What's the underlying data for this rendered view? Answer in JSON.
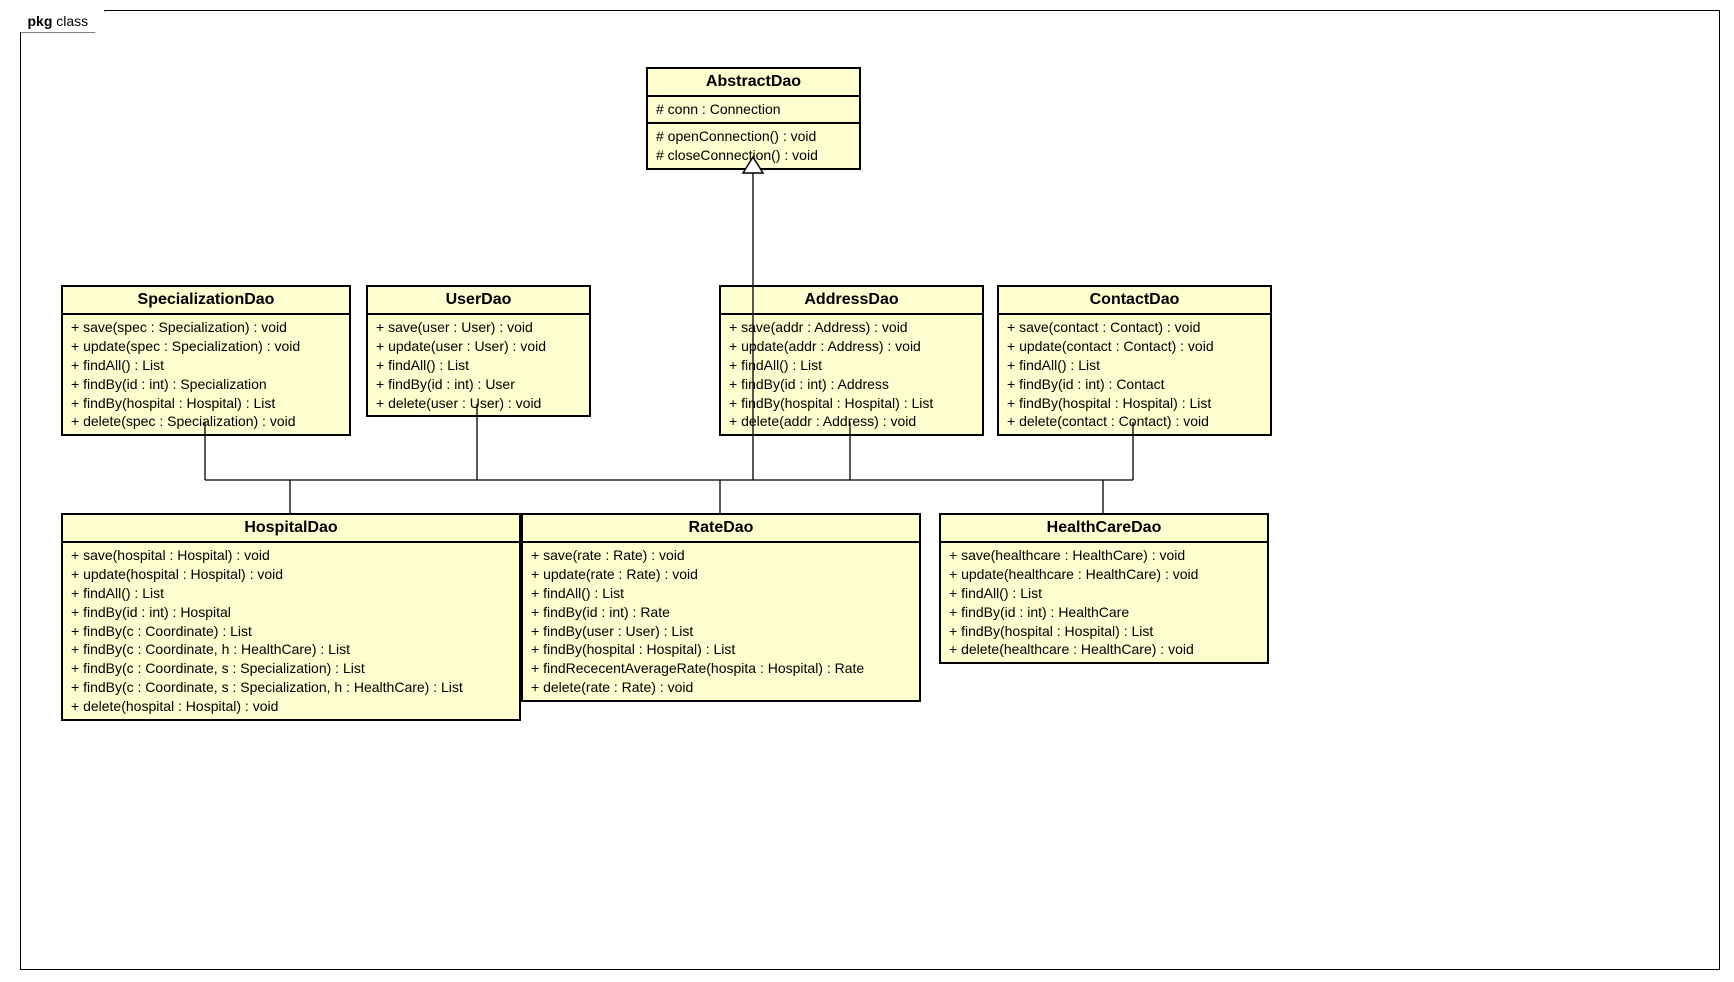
{
  "frame": {
    "pkg_label": "pkg",
    "name": "class"
  },
  "classes": {
    "abstractDao": {
      "title": "AbstractDao",
      "attrs": [
        "# conn : Connection"
      ],
      "ops": [
        "# openConnection() : void",
        "# closeConnection() : void"
      ]
    },
    "specializationDao": {
      "title": "SpecializationDao",
      "ops": [
        "+ save(spec : Specialization) : void",
        "+ update(spec : Specialization) : void",
        "+ findAll() : List",
        "+ findBy(id : int) : Specialization",
        "+ findBy(hospital : Hospital) : List",
        "+ delete(spec : Specialization) : void"
      ]
    },
    "userDao": {
      "title": "UserDao",
      "ops": [
        "+ save(user : User) : void",
        "+ update(user : User) : void",
        "+ findAll() : List",
        "+ findBy(id : int) : User",
        "+ delete(user : User) : void"
      ]
    },
    "addressDao": {
      "title": "AddressDao",
      "ops": [
        "+ save(addr : Address) : void",
        "+ update(addr : Address) : void",
        "+ findAll() : List",
        "+ findBy(id : int) : Address",
        "+ findBy(hospital : Hospital) : List",
        "+ delete(addr : Address) : void"
      ]
    },
    "contactDao": {
      "title": "ContactDao",
      "ops": [
        "+ save(contact : Contact) : void",
        "+ update(contact : Contact) : void",
        "+ findAll() : List",
        "+ findBy(id : int) : Contact",
        "+ findBy(hospital : Hospital) : List",
        "+ delete(contact : Contact) : void"
      ]
    },
    "hospitalDao": {
      "title": "HospitalDao",
      "ops": [
        "+ save(hospital : Hospital) : void",
        "+ update(hospital : Hospital) : void",
        "+ findAll() : List",
        "+ findBy(id : int) : Hospital",
        "+ findBy(c : Coordinate) : List",
        "+ findBy(c : Coordinate, h : HealthCare) : List",
        "+ findBy(c : Coordinate, s : Specialization) : List",
        "+ findBy(c : Coordinate, s : Specialization, h : HealthCare) : List",
        "+ delete(hospital : Hospital) : void"
      ]
    },
    "rateDao": {
      "title": "RateDao",
      "ops": [
        "+ save(rate : Rate) : void",
        "+ update(rate : Rate) : void",
        "+ findAll() : List",
        "+ findBy(id : int) : Rate",
        "+ findBy(user : User) : List",
        "+ findBy(hospital : Hospital) : List",
        "+ findRececentAverageRate(hospita : Hospital) : Rate",
        "+ delete(rate : Rate) : void"
      ]
    },
    "healthCareDao": {
      "title": "HealthCareDao",
      "ops": [
        "+ save(healthcare : HealthCare) : void",
        "+ update(healthcare : HealthCare) : void",
        "+ findAll() : List",
        "+ findBy(id : int) : HealthCare",
        "+ findBy(hospital : Hospital) : List",
        "+ delete(healthcare : HealthCare) : void"
      ]
    }
  }
}
